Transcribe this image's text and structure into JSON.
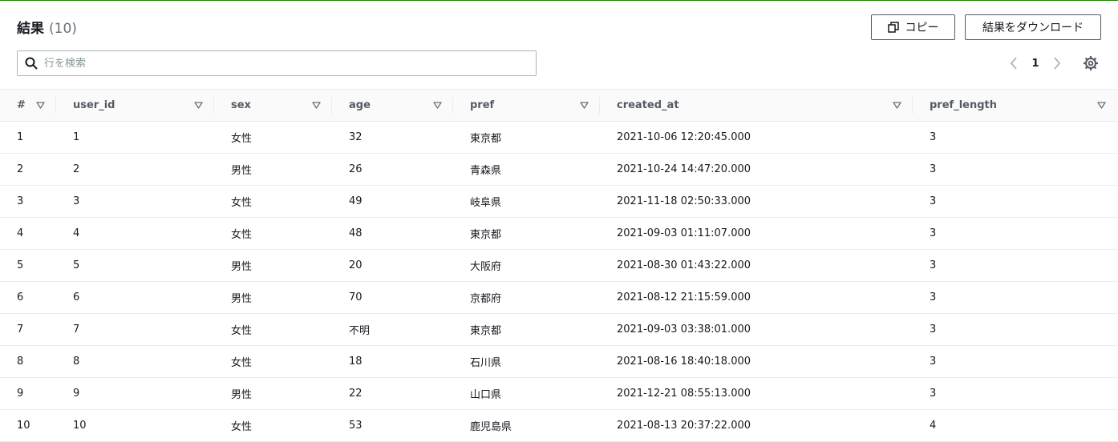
{
  "header": {
    "title": "結果",
    "count": "(10)"
  },
  "buttons": {
    "copy": "コピー",
    "download": "結果をダウンロード"
  },
  "search": {
    "placeholder": "行を検索",
    "value": ""
  },
  "pagination": {
    "current_page": "1"
  },
  "icons": {
    "search": "search-icon",
    "copy": "copy-icon",
    "prev": "chevron-left-icon",
    "next": "chevron-right-icon",
    "settings": "gear-icon",
    "sort": "sort-triangle-icon"
  },
  "colors": {
    "top_border": "#1d8102",
    "text": "#16191f",
    "header_text": "#545b64"
  },
  "table": {
    "columns": [
      "#",
      "user_id",
      "sex",
      "age",
      "pref",
      "created_at",
      "pref_length"
    ],
    "rows": [
      [
        "1",
        "1",
        "女性",
        "32",
        "東京都",
        "2021-10-06 12:20:45.000",
        "3"
      ],
      [
        "2",
        "2",
        "男性",
        "26",
        "青森県",
        "2021-10-24 14:47:20.000",
        "3"
      ],
      [
        "3",
        "3",
        "女性",
        "49",
        "岐阜県",
        "2021-11-18 02:50:33.000",
        "3"
      ],
      [
        "4",
        "4",
        "女性",
        "48",
        "東京都",
        "2021-09-03 01:11:07.000",
        "3"
      ],
      [
        "5",
        "5",
        "男性",
        "20",
        "大阪府",
        "2021-08-30 01:43:22.000",
        "3"
      ],
      [
        "6",
        "6",
        "男性",
        "70",
        "京都府",
        "2021-08-12 21:15:59.000",
        "3"
      ],
      [
        "7",
        "7",
        "女性",
        "不明",
        "東京都",
        "2021-09-03 03:38:01.000",
        "3"
      ],
      [
        "8",
        "8",
        "女性",
        "18",
        "石川県",
        "2021-08-16 18:40:18.000",
        "3"
      ],
      [
        "9",
        "9",
        "男性",
        "22",
        "山口県",
        "2021-12-21 08:55:13.000",
        "3"
      ],
      [
        "10",
        "10",
        "女性",
        "53",
        "鹿児島県",
        "2021-08-13 20:37:22.000",
        "4"
      ]
    ]
  }
}
